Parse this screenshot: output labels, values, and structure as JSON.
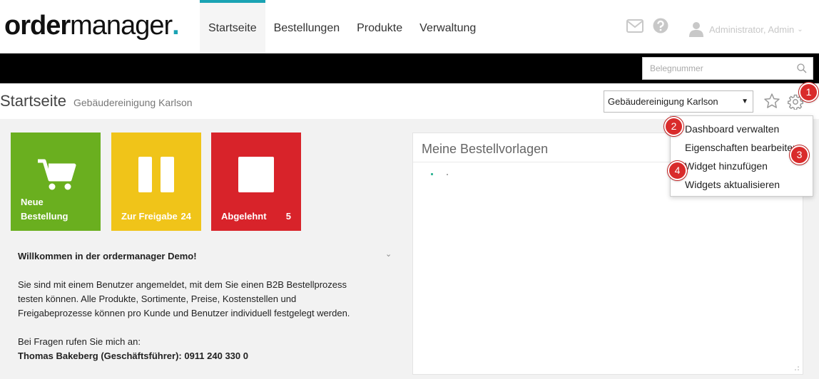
{
  "header": {
    "logo_bold": "order",
    "logo_light": "manager",
    "logo_dot": ".",
    "nav": [
      {
        "label": "Startseite",
        "active": true
      },
      {
        "label": "Bestellungen"
      },
      {
        "label": "Produkte"
      },
      {
        "label": "Verwaltung"
      }
    ],
    "user_name": "Administrator, Admin",
    "user_chevron": "⌄"
  },
  "search": {
    "placeholder": "Belegnummer"
  },
  "page": {
    "title": "Startseite",
    "subtitle": "Gebäudereinigung Karlson",
    "customer_select": "Gebäudereinigung Karlson",
    "select_arrow": "▼"
  },
  "tiles": [
    {
      "label_line1": "Neue",
      "label_line2": "Bestellung",
      "color": "#6aaf1f"
    },
    {
      "label": "Zur Freigabe",
      "count": "24",
      "color": "#f0c419"
    },
    {
      "label": "Abgelehnt",
      "count": "5",
      "color": "#d8232a"
    }
  ],
  "welcome": {
    "heading": "Willkommen in der ordermanager Demo!",
    "para1": "Sie sind mit einem Benutzer angemeldet, mit dem Sie einen B2B Bestellprozess testen können. Alle Produkte, Sortimente, Preise, Kostenstellen und Freigabeprozesse können pro Kunde und Benutzer individuell festgelegt werden.",
    "para2_line1": "Bei Fragen rufen Sie mich an:",
    "para2_line2": "Thomas Bakeberg (Geschäftsführer): 0911 240 330 0",
    "chevron": "⌄"
  },
  "widget": {
    "title": "Meine Bestellvorlagen"
  },
  "menu": {
    "items": [
      "Dashboard verwalten",
      "Eigenschaften bearbeiten",
      "Widget hinzufügen",
      "Widgets aktualisieren"
    ]
  },
  "markers": [
    "1",
    "2",
    "3",
    "4"
  ],
  "icons": {
    "mail": "envelope-icon",
    "help": "question-circle-icon",
    "user": "user-icon",
    "search": "magnifier-icon",
    "star": "star-icon",
    "gear": "gear-icon",
    "cart": "cart-icon",
    "pause": "pause-icon",
    "stop": "stop-icon"
  },
  "colors": {
    "accent": "#1aa3b3",
    "marker": "#d92b2b"
  }
}
